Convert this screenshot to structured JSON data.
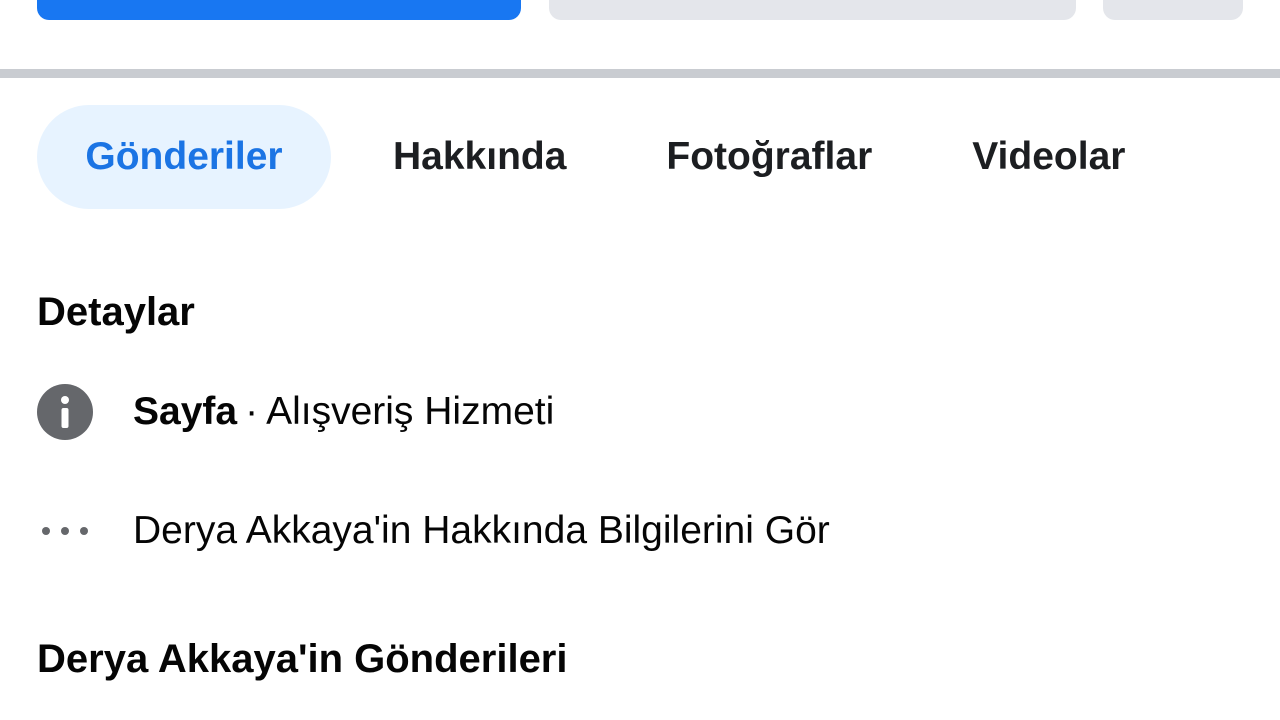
{
  "top_actions": {
    "primary_color": "#1877f2",
    "secondary_color": "#e4e6eb"
  },
  "tabs": [
    {
      "label": "Gönderiler",
      "active": true
    },
    {
      "label": "Hakkında",
      "active": false
    },
    {
      "label": "Fotoğraflar",
      "active": false
    },
    {
      "label": "Videolar",
      "active": false
    }
  ],
  "details": {
    "title": "Detaylar",
    "page_type": {
      "icon": "info-icon",
      "label": "Sayfa",
      "separator": "·",
      "category": "Alışveriş Hizmeti"
    },
    "more_info": {
      "icon": "more-dots-icon",
      "label": "Derya Akkaya'in Hakkında Bilgilerini Gör"
    }
  },
  "posts": {
    "title": "Derya Akkaya'in Gönderileri"
  },
  "colors": {
    "accent": "#1b74e4",
    "active_tab_bg": "#e7f3ff",
    "icon_gray": "#65676b"
  }
}
